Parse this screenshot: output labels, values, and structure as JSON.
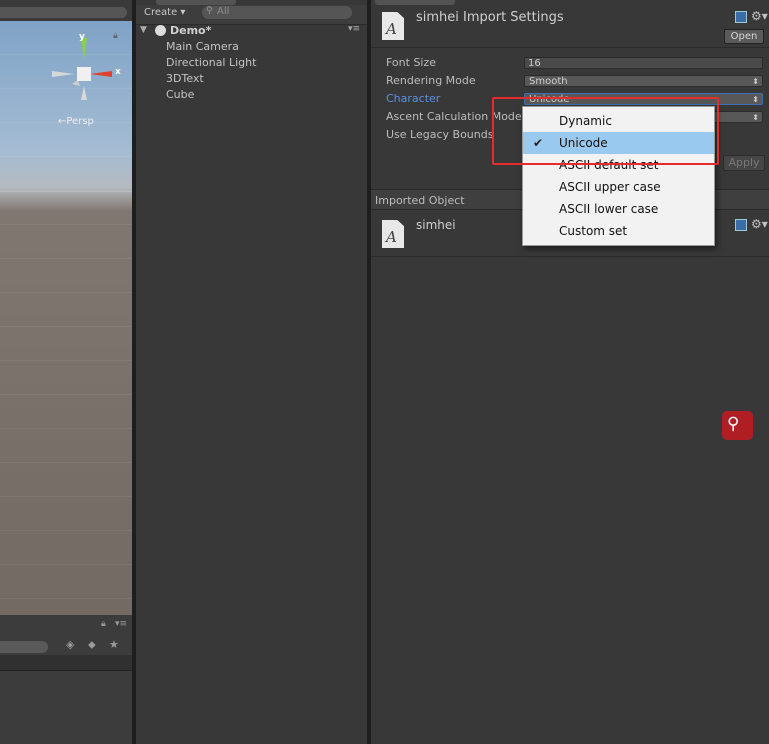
{
  "scene": {
    "gizmo": {
      "y": "y",
      "x": "x"
    },
    "persp_label": "←Persp"
  },
  "hierarchy": {
    "create_label": "Create ▾",
    "search_placeholder": "All",
    "scene_name": "Demo*",
    "items": [
      "Main Camera",
      "Directional Light",
      "3DText",
      "Cube"
    ]
  },
  "inspector": {
    "title": "simhei Import Settings",
    "open_label": "Open",
    "font_icon_letter": "A",
    "properties": {
      "font_size": {
        "label": "Font Size",
        "value": "16"
      },
      "rendering_mode": {
        "label": "Rendering Mode",
        "value": "Smooth"
      },
      "character": {
        "label": "Character",
        "value": "Unicode"
      },
      "ascent": {
        "label": "Ascent Calculation Mode"
      },
      "legacy": {
        "label": "Use Legacy Bounds"
      }
    },
    "apply_label": "Apply",
    "imported_object_label": "Imported Object",
    "imported_name": "simhei"
  },
  "dropdown": {
    "options": [
      "Dynamic",
      "Unicode",
      "ASCII default set",
      "ASCII upper case",
      "ASCII lower case",
      "Custom set"
    ],
    "selected": "Unicode"
  },
  "colors": {
    "selection": "#99c9ef",
    "highlight_border": "#e32d2d",
    "active_label": "#5d8fe0",
    "float_search": "#b01e23"
  }
}
